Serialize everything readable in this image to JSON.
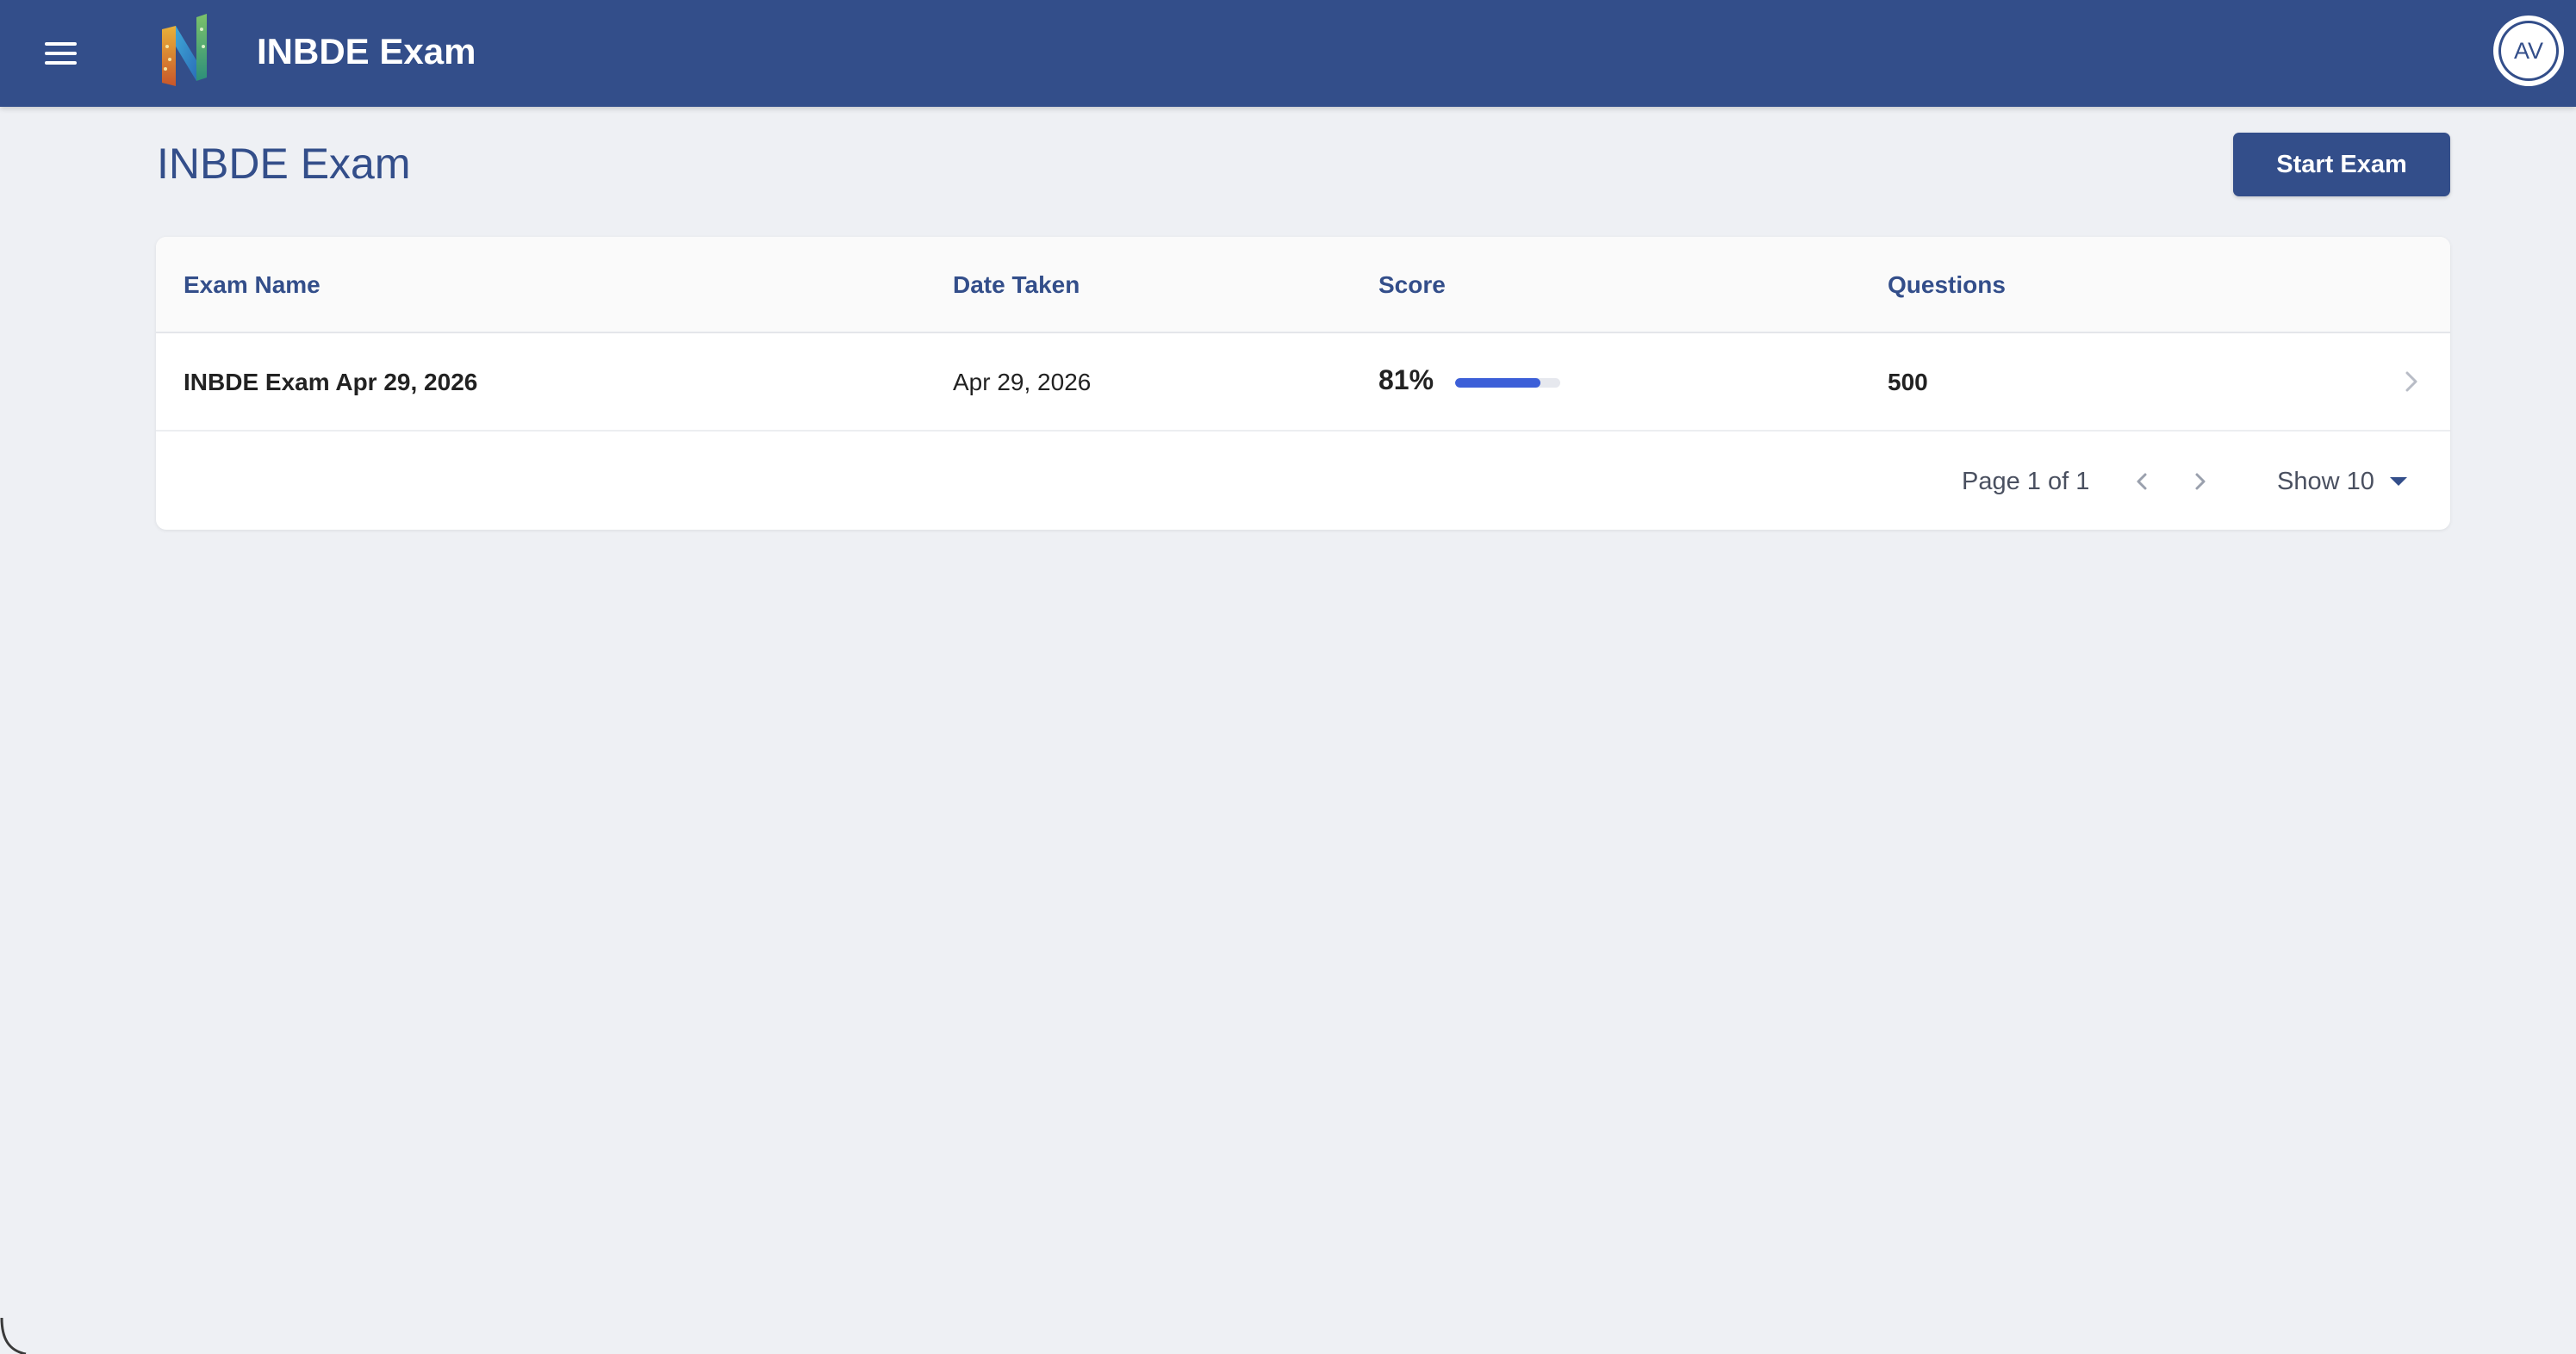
{
  "header": {
    "app_title": "INBDE Exam",
    "avatar_initials": "AV",
    "brand_color": "#334e8a"
  },
  "page": {
    "title": "INBDE Exam",
    "start_button_label": "Start Exam"
  },
  "table": {
    "columns": [
      "Exam Name",
      "Date Taken",
      "Score",
      "Questions"
    ],
    "rows": [
      {
        "exam_name": "INBDE Exam Apr 29, 2026",
        "date_taken": "Apr 29, 2026",
        "score": "81%",
        "score_fraction": 0.81,
        "questions": "500"
      }
    ]
  },
  "pagination": {
    "page_label": "Page 1 of 1",
    "show_label": "Show 10"
  },
  "icons": {
    "menu": "hamburger-menu-icon",
    "logo": "app-logo",
    "row_chevron": "chevron-right-icon",
    "prev": "chevron-left-icon",
    "next": "chevron-right-icon",
    "dropdown": "caret-down-icon"
  },
  "colors": {
    "page_bg": "#eef0f4",
    "progress_fill": "#3c5fd8",
    "progress_track": "#e6e8ee"
  }
}
